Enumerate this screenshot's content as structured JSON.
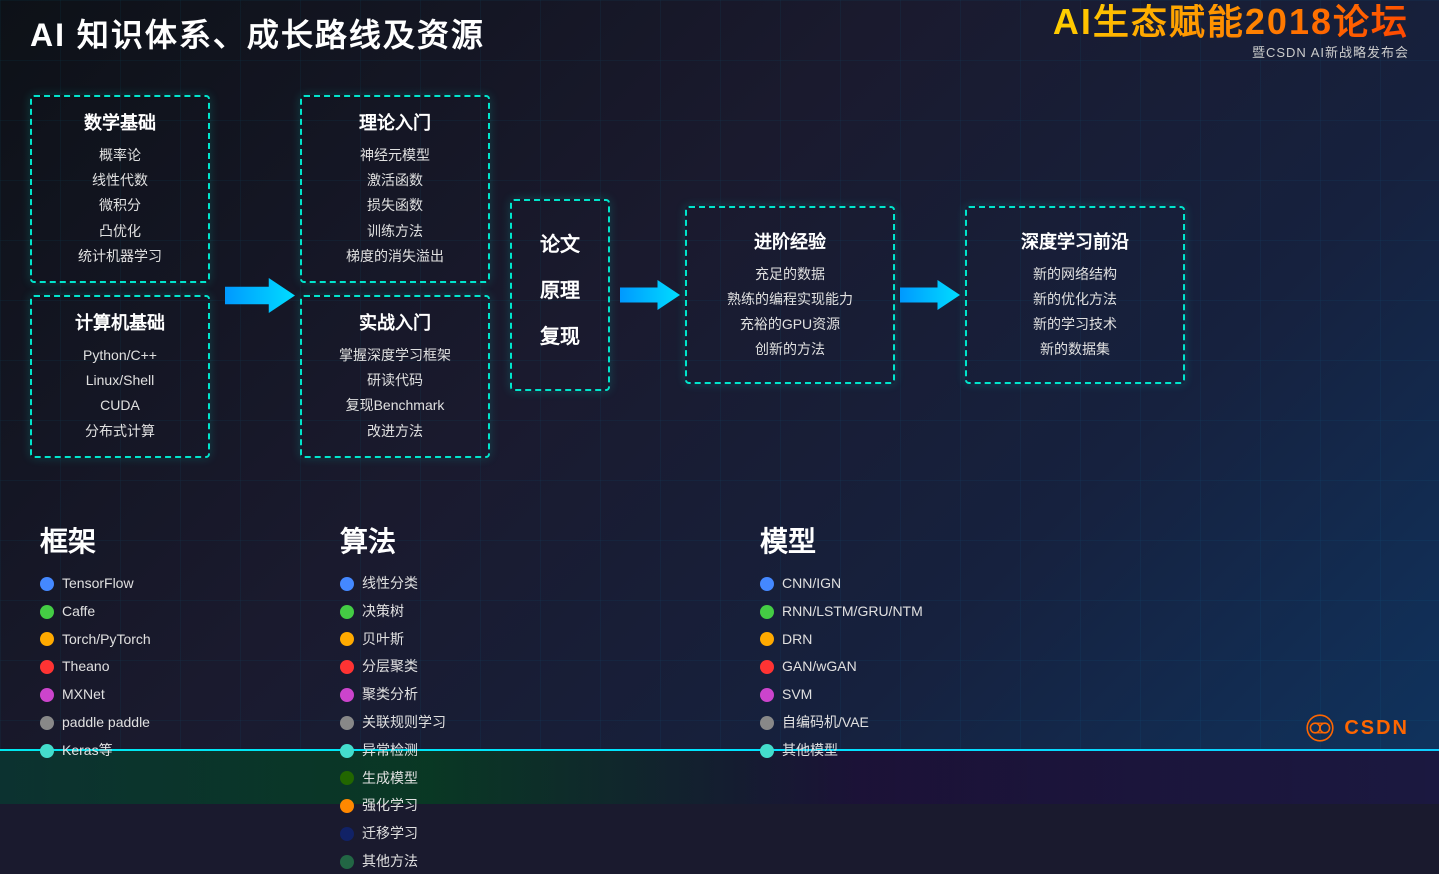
{
  "header": {
    "title": "AI 知识体系、成长路线及资源",
    "logo_main": "AI生态赋能2018论坛",
    "logo_sub": "暨CSDN AI新战略发布会"
  },
  "flowchart": {
    "col1": {
      "box1": {
        "title": "数学基础",
        "items": [
          "概率论",
          "线性代数",
          "微积分",
          "凸优化",
          "统计机器学习"
        ]
      },
      "box2": {
        "title": "计算机基础",
        "items": [
          "Python/C++",
          "Linux/Shell",
          "CUDA",
          "分布式计算"
        ]
      }
    },
    "arrow1": "→",
    "col2": {
      "box1": {
        "title": "理论入门",
        "items": [
          "神经元模型",
          "激活函数",
          "损失函数",
          "训练方法",
          "梯度的消失溢出"
        ]
      },
      "box2": {
        "title": "实战入门",
        "items": [
          "掌握深度学习框架",
          "研读代码",
          "复现Benchmark",
          "改进方法"
        ]
      }
    },
    "col3": {
      "title": "论文\n原理\n复现",
      "title_lines": [
        "论文",
        "原理",
        "复现"
      ]
    },
    "arrow2": "→",
    "col4": {
      "title": "进阶经验",
      "items": [
        "充足的数据",
        "熟练的编程实现能力",
        "充裕的GPU资源",
        "创新的方法"
      ]
    },
    "arrow3": "→",
    "col5": {
      "title": "深度学习前沿",
      "items": [
        "新的网络结构",
        "新的优化方法",
        "新的学习技术",
        "新的数据集"
      ]
    }
  },
  "frameworks": {
    "label": "框架",
    "items": [
      {
        "color": "#4488ff",
        "name": "TensorFlow"
      },
      {
        "color": "#44cc44",
        "name": "Caffe"
      },
      {
        "color": "#ffaa00",
        "name": "Torch/PyTorch"
      },
      {
        "color": "#ff3333",
        "name": "Theano"
      },
      {
        "color": "#cc44cc",
        "name": "MXNet"
      },
      {
        "color": "#888888",
        "name": "paddle paddle"
      },
      {
        "color": "#44ddcc",
        "name": "Keras等"
      }
    ]
  },
  "algorithms": {
    "label": "算法",
    "items": [
      {
        "color": "#4488ff",
        "name": "线性分类"
      },
      {
        "color": "#44cc44",
        "name": "决策树"
      },
      {
        "color": "#ffaa00",
        "name": "贝叶斯"
      },
      {
        "color": "#ff3333",
        "name": "分层聚类"
      },
      {
        "color": "#cc44cc",
        "name": "聚类分析"
      },
      {
        "color": "#888888",
        "name": "关联规则学习"
      },
      {
        "color": "#44ddcc",
        "name": "异常检测"
      },
      {
        "color": "#226600",
        "name": "生成模型"
      },
      {
        "color": "#ff8800",
        "name": "强化学习"
      },
      {
        "color": "#112266",
        "name": "迁移学习"
      },
      {
        "color": "#226644",
        "name": "其他方法"
      }
    ]
  },
  "models": {
    "label": "模型",
    "items": [
      {
        "color": "#4488ff",
        "name": "CNN/IGN"
      },
      {
        "color": "#44cc44",
        "name": "RNN/LSTM/GRU/NTM"
      },
      {
        "color": "#ffaa00",
        "name": "DRN"
      },
      {
        "color": "#ff3333",
        "name": "GAN/wGAN"
      },
      {
        "color": "#cc44cc",
        "name": "SVM"
      },
      {
        "color": "#888888",
        "name": "自编码机/VAE"
      },
      {
        "color": "#44ddcc",
        "name": "其他模型"
      }
    ]
  },
  "csdn": {
    "label": "CSDN"
  }
}
